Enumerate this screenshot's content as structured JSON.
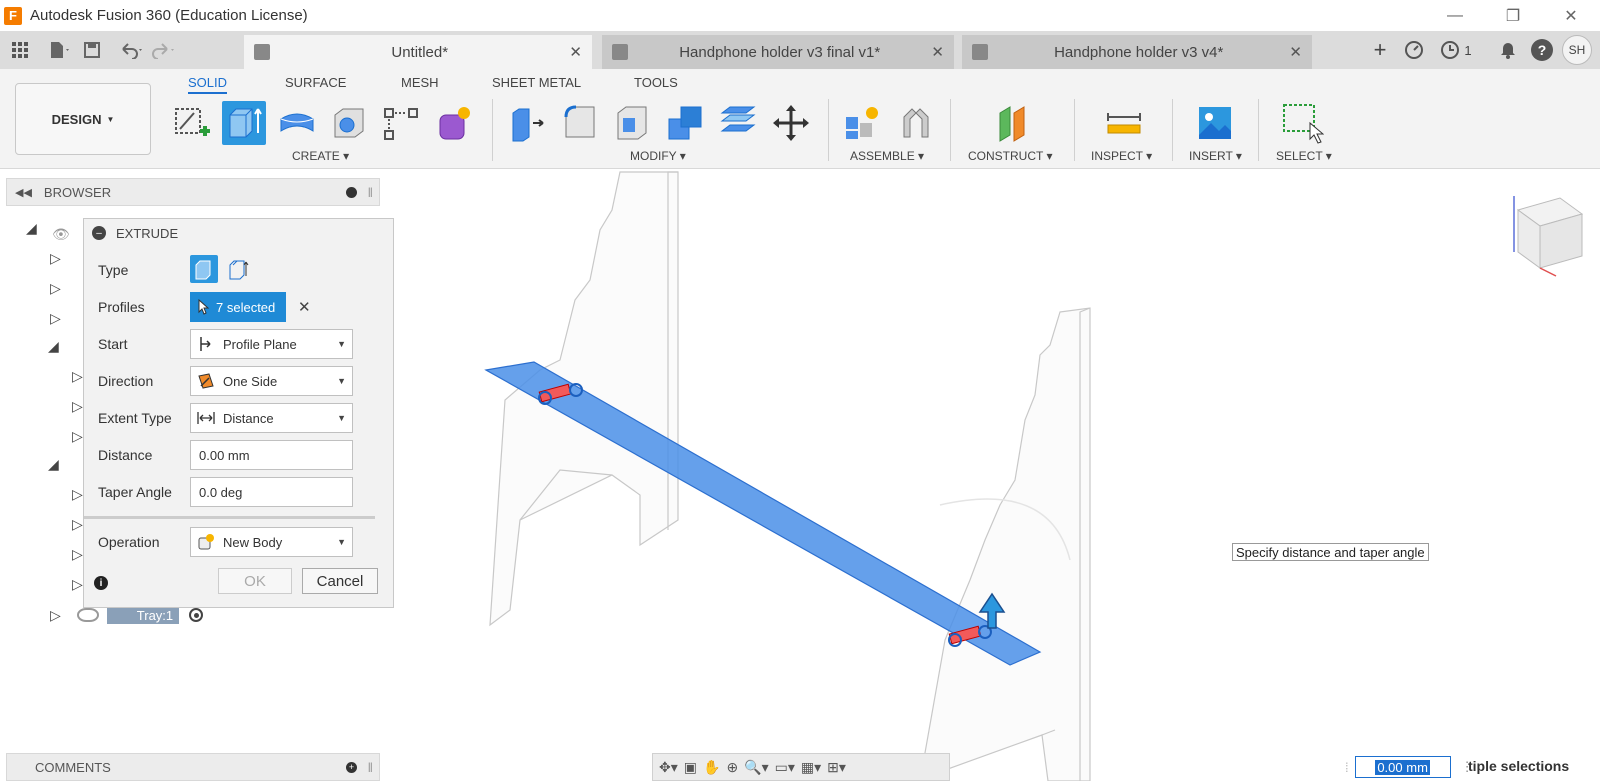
{
  "window": {
    "title": "Autodesk Fusion 360 (Education License)",
    "logo_letter": "F",
    "minimize": "—",
    "restore": "❐",
    "close": "✕"
  },
  "tabs": [
    {
      "label": "Untitled*",
      "close": "✕"
    },
    {
      "label": "Handphone holder v3 final v1*",
      "close": "✕"
    },
    {
      "label": "Handphone holder v3 v4*",
      "close": "✕"
    }
  ],
  "topbar": {
    "add_tab": "+",
    "jobs_count": "1",
    "help": "?",
    "user_initials": "SH"
  },
  "ribbon": {
    "workspace": "DESIGN",
    "tabs": [
      "SOLID",
      "SURFACE",
      "MESH",
      "SHEET METAL",
      "TOOLS"
    ],
    "groups": [
      "CREATE",
      "MODIFY",
      "ASSEMBLE",
      "CONSTRUCT",
      "INSPECT",
      "INSERT",
      "SELECT"
    ]
  },
  "browser": {
    "title": "BROWSER",
    "tray_item": "Tray:1"
  },
  "extrude": {
    "title": "EXTRUDE",
    "labels": {
      "type": "Type",
      "profiles": "Profiles",
      "start": "Start",
      "direction": "Direction",
      "extent_type": "Extent Type",
      "distance": "Distance",
      "taper_angle": "Taper Angle",
      "operation": "Operation"
    },
    "profiles_value": "7 selected",
    "profiles_clear": "✕",
    "start_value": "Profile Plane",
    "direction_value": "One Side",
    "extent_value": "Distance",
    "distance_value": "0.00 mm",
    "taper_value": "0.0 deg",
    "operation_value": "New Body",
    "ok": "OK",
    "cancel": "Cancel"
  },
  "viewport": {
    "tooltip": "Specify distance and taper angle",
    "value_input": "0.00 mm",
    "status": "tiple selections"
  },
  "comments": {
    "title": "COMMENTS"
  },
  "colors": {
    "accent": "#2c97de",
    "plate": "#4a8fe8",
    "ribbon_bg": "#f3f3f3"
  }
}
